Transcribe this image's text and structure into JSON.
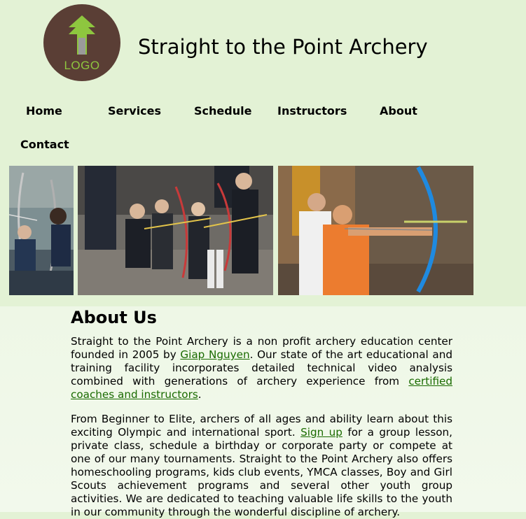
{
  "site": {
    "title": "Straight to the Point Archery",
    "logo_text": "LOGO"
  },
  "nav": {
    "items": [
      "Home",
      "Services",
      "Schedule",
      "Instructors",
      "About",
      "Contact"
    ]
  },
  "about": {
    "heading": "About Us",
    "p1_a": "Straight to the Point Archery is a non profit archery education center founded in 2005 by ",
    "p1_link1": "Giap Nguyen",
    "p1_b": ". Our state of the art educational and training facility incorporates detailed technical video analysis combined with generations of archery experience from ",
    "p1_link2": "certified coaches and instructors",
    "p1_c": ".",
    "p2_a": "From Beginner to Elite, archers of all ages and ability learn about this exciting Olympic and international sport. ",
    "p2_link": "Sign up",
    "p2_b": " for a group lesson, private class, schedule a birthday or corporate party or compete at one of our many tournaments. Straight to the Point Archery also offers homeschooling programs, kids club events, YMCA classes, Boy and Girl Scouts achievement programs and several other youth group activities. We are dedicated to teaching valuable life skills to the youth in our community through the wonderful discipline of archery."
  },
  "colors": {
    "header_bg": "#e3f2d5",
    "logo_bg": "#5a3e35",
    "logo_accent": "#8ec63f",
    "link": "#1a6b00"
  },
  "icons": [
    "arrow-up-logo-icon"
  ]
}
